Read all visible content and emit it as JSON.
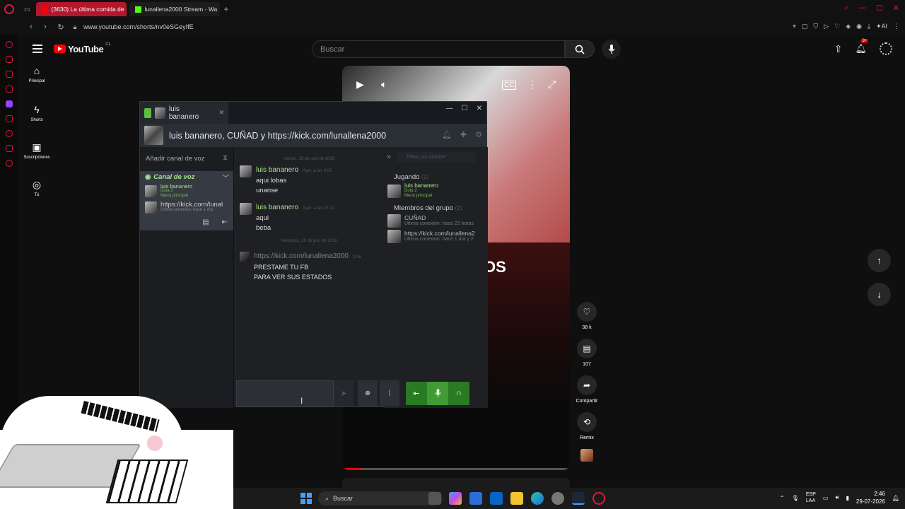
{
  "browser": {
    "tabs": [
      {
        "label": "(3630) La última comida de",
        "active": true
      },
      {
        "label": "lunallena2000 Stream - Wa",
        "active": false
      }
    ],
    "new_tab": "+",
    "url": "www.youtube.com/shorts/nv0eSGeyIfE"
  },
  "youtube": {
    "logo_text": "YouTube",
    "country_code": "CL",
    "search_placeholder": "Buscar",
    "notification_count": "9+",
    "guide": [
      {
        "label": "Principal",
        "icon": "home-icon"
      },
      {
        "label": "Shorts",
        "icon": "shorts-icon"
      },
      {
        "label": "Suscripciones",
        "icon": "subscriptions-icon"
      },
      {
        "label": "Tú",
        "icon": "you-icon"
      }
    ],
    "short": {
      "overlay_text": "OS",
      "progress": 0.08,
      "likes": "38 k",
      "comments": "107",
      "share_label": "Compartir",
      "remix_label": "Remix"
    }
  },
  "steam": {
    "tab_name": "luis bananero",
    "group_title": "luis bananero, CUÑAD y https://kick.com/lunallena2000",
    "voice": {
      "add_channel": "Añadir canal de voz",
      "channel_name": "Canal de voz",
      "members": [
        {
          "name": "luis bananero",
          "status1": "Dota 2",
          "status2": "Menú principal"
        },
        {
          "name": "https://kick.com/lunal",
          "status1": "Última conexión: hace 1 día"
        }
      ]
    },
    "chat": {
      "date1": "martes, 28 de julio de 2026",
      "messages": [
        {
          "author": "luis bananero",
          "time": "Ayer, a las 0:02",
          "lines": [
            "aqui lobas",
            "unanse"
          ]
        },
        {
          "author": "luis bananero",
          "time": "Ayer, a las 22:22",
          "lines": [
            "aqui",
            "beba"
          ]
        }
      ],
      "date2": "miércoles, 29 de julio de 2026",
      "last_message": {
        "author": "https://kick.com/lunallena2000",
        "time": "2:46",
        "lines": [
          "PRESTAME TU FB",
          "PARA VER SUS ESTADOS"
        ]
      }
    },
    "members_panel": {
      "search_placeholder": "Filtrar por nombre",
      "playing_label": "Jugando",
      "playing_count": "(1)",
      "playing": [
        {
          "name": "luis bananero",
          "status1": "Dota 2",
          "status2": "Menú principal"
        }
      ],
      "group_label": "Miembros del grupo",
      "group_count": "(2)",
      "group": [
        {
          "name": "CUÑAD",
          "status": "Última conexión: hace 22 horas"
        },
        {
          "name": "https://kick.com/lunallena2",
          "status": "Última conexión: hace 1 día y 2"
        }
      ]
    }
  },
  "taskbar": {
    "search_placeholder": "Buscar",
    "lang1": "ESP",
    "lang2": "LAA",
    "time": "2:46",
    "date": "29-07-2026"
  }
}
